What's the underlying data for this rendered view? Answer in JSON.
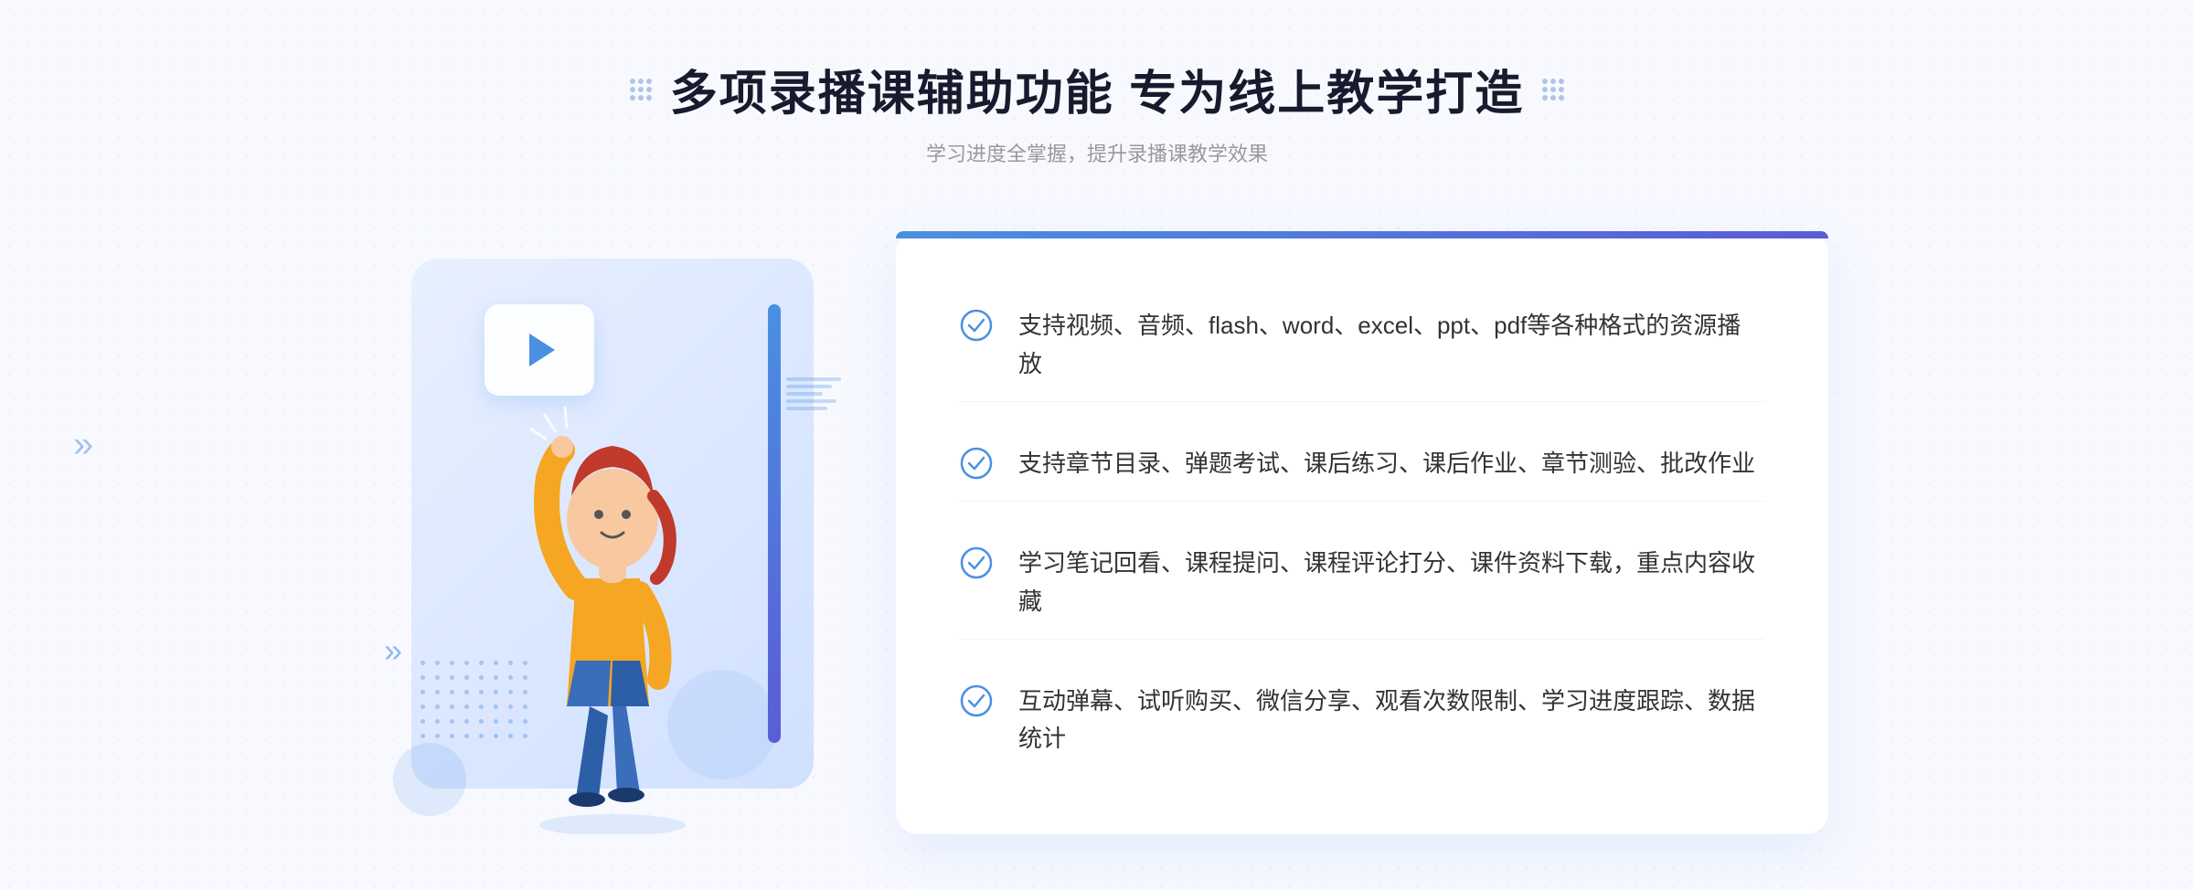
{
  "page": {
    "background_color": "#f8f9ff"
  },
  "header": {
    "title": "多项录播课辅助功能 专为线上教学打造",
    "subtitle": "学习进度全掌握，提升录播课教学效果"
  },
  "features": [
    {
      "id": 1,
      "text": "支持视频、音频、flash、word、excel、ppt、pdf等各种格式的资源播放"
    },
    {
      "id": 2,
      "text": "支持章节目录、弹题考试、课后练习、课后作业、章节测验、批改作业"
    },
    {
      "id": 3,
      "text": "学习笔记回看、课程提问、课程评论打分、课件资料下载，重点内容收藏"
    },
    {
      "id": 4,
      "text": "互动弹幕、试听购买、微信分享、观看次数限制、学习进度跟踪、数据统计"
    }
  ],
  "icons": {
    "check": "check-circle-icon",
    "play": "play-icon",
    "arrow_left": "»"
  },
  "colors": {
    "primary": "#4a90e2",
    "primary_dark": "#5b5bd6",
    "text_main": "#1a1a2e",
    "text_secondary": "#999999",
    "text_feature": "#333333",
    "bg_light": "#f8f9ff",
    "card_bg": "#ffffff"
  }
}
